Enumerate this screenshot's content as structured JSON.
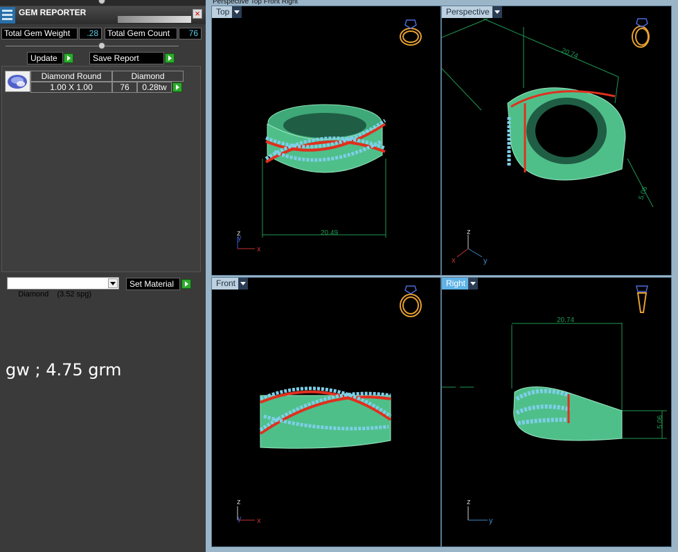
{
  "gem_reporter": {
    "title": "GEM REPORTER",
    "close_label": "×",
    "total_weight_label": "Total Gem Weight",
    "total_weight_value": ".28",
    "total_count_label": "Total Gem Count",
    "total_count_value": "76",
    "update_label": "Update",
    "save_report_label": "Save Report",
    "table": {
      "header_shape": "Diamond Round",
      "header_material": "Diamond",
      "size": "1.00 X 1.00",
      "count": "76",
      "weight": "0.28tw"
    }
  },
  "material": {
    "selected": "Diamond    (3.52 spg)",
    "set_label": "Set Material"
  },
  "note": "gw ; 4.75 grm",
  "viewport_tabs_top": "Perspective   Top   Front   Right",
  "viewports": {
    "top": {
      "label": "Top",
      "dimension": "20.49",
      "axis_x": "x",
      "axis_y": "y",
      "axis_z": "z"
    },
    "perspective": {
      "label": "Perspective",
      "dimension_a": "20.74",
      "dimension_b": "5.06",
      "axis_x": "x",
      "axis_y": "y",
      "axis_z": "z"
    },
    "front": {
      "label": "Front",
      "axis_x": "x",
      "axis_y": "y",
      "axis_z": "z"
    },
    "right": {
      "label": "Right",
      "dimension_a": "20.74",
      "dimension_b": "5.06",
      "axis_y": "y",
      "axis_z": "z"
    }
  },
  "colors": {
    "ring_fill": "#4fbf8a",
    "gem": "#7ecfe8",
    "prong": "#e0301e",
    "dim_line": "#1f9a55",
    "view_icon": "#e8a030"
  }
}
